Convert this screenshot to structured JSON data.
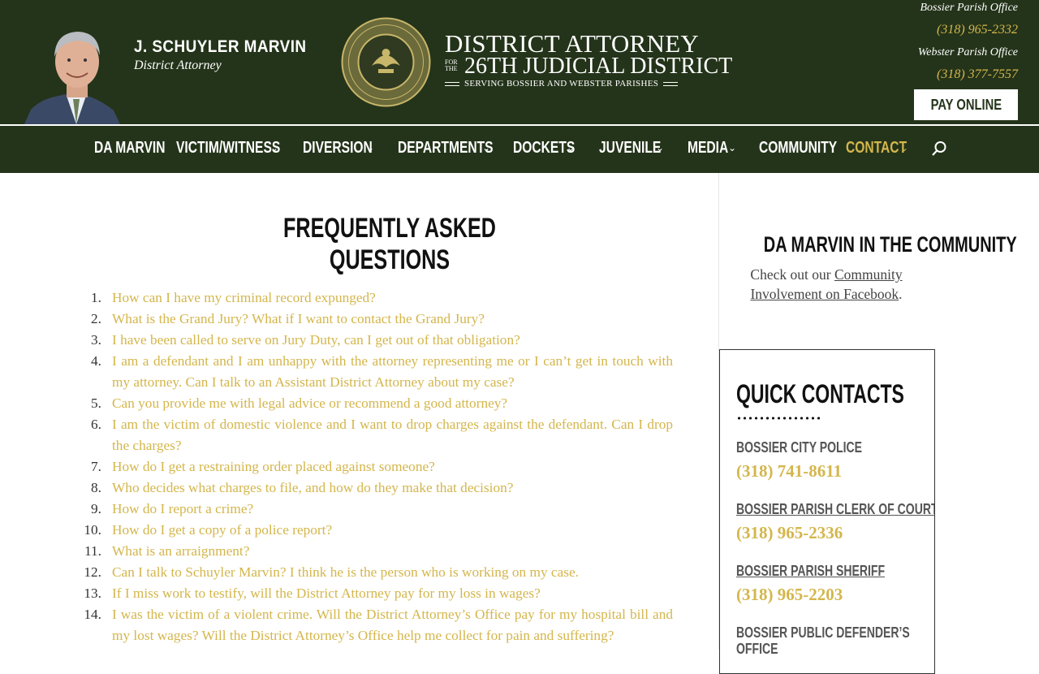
{
  "header": {
    "da_name": "J. SCHUYLER MARVIN",
    "da_role": "District Attorney",
    "logo": {
      "line1": "DISTRICT ATTORNEY",
      "for_the": "FOR THE",
      "line2": "26TH JUDICIAL DISTRICT",
      "line3": "SERVING BOSSIER AND WEBSTER PARISHES"
    },
    "offices": [
      {
        "name": "Bossier Parish Office",
        "phone": "(318) 965-2332"
      },
      {
        "name": "Webster Parish Office",
        "phone": "(318) 377-7557"
      }
    ],
    "pay_label": "PAY ONLINE"
  },
  "nav": {
    "items": [
      {
        "label": "DA MARVIN"
      },
      {
        "label": "VICTIM/WITNESS"
      },
      {
        "label": "DIVERSION"
      },
      {
        "label": "DEPARTMENTS"
      },
      {
        "label": "DOCKETS"
      },
      {
        "label": "JUVENILE"
      },
      {
        "label": "MEDIA"
      },
      {
        "label": "COMMUNITY"
      },
      {
        "label": "CONTACT"
      }
    ],
    "dropdown_glyph": "⌄",
    "active_color": "#d4b64c"
  },
  "main": {
    "title": "FREQUENTLY ASKED QUESTIONS",
    "questions": [
      {
        "num": "1.",
        "text": "How can I have my criminal record expunged?"
      },
      {
        "num": "2.",
        "text": "What is the Grand Jury? What if I want to contact the Grand Jury?"
      },
      {
        "num": "3.",
        "text": "I have been called to serve on Jury Duty, can I get out of that obligation?"
      },
      {
        "num": "4.",
        "text": "I am a defendant and I am unhappy with the attorney representing me or I can’t get in touch with my attorney. Can I talk to an Assistant District Attorney about my case?"
      },
      {
        "num": "5.",
        "text": "Can you provide me with legal advice or recommend a good attorney?"
      },
      {
        "num": "6.",
        "text": "I am the victim of domestic violence and I want to drop charges against the defendant. Can I drop the charges?"
      },
      {
        "num": "7.",
        "text": "How do I get a restraining order placed against someone?"
      },
      {
        "num": "8.",
        "text": "Who decides what charges to file, and how do they make that decision?"
      },
      {
        "num": "9.",
        "text": "How do I report a crime?"
      },
      {
        "num": "10.",
        "text": "How do I get a copy of a police report?"
      },
      {
        "num": "11.",
        "text": "What is an arraignment?"
      },
      {
        "num": "12.",
        "text": "Can I talk to Schuyler Marvin? I think he is the person who is working on my case."
      },
      {
        "num": "13.",
        "text": "If I miss work to testify, will the District Attorney pay for my loss in wages?"
      },
      {
        "num": "14.",
        "text": "I was the victim of a violent crime. Will the District Attorney’s Office pay for my hospital bill and my lost wages? Will the District Attorney’s Office help me collect for pain and suffering?"
      }
    ]
  },
  "sidebar": {
    "community_title": "DA MARVIN IN THE COMMUNITY",
    "community_pre": "Check out our",
    "community_link": "Community Involvement on Facebook",
    "community_post": ".",
    "quick_contacts_title": "QUICK CONTACTS",
    "contacts": [
      {
        "label": "BOSSIER CITY POLICE",
        "phone": "(318) 741-8611"
      },
      {
        "label": "BOSSIER PARISH CLERK OF COURT",
        "phone": "(318) 965-2336"
      },
      {
        "label": "BOSSIER PARISH SHERIFF",
        "phone": "(318) 965-2203"
      },
      {
        "label": "BOSSIER PUBLIC DEFENDER’S OFFICE"
      }
    ]
  },
  "colors": {
    "header_green": "#24341a",
    "gold": "#d4b64c"
  }
}
